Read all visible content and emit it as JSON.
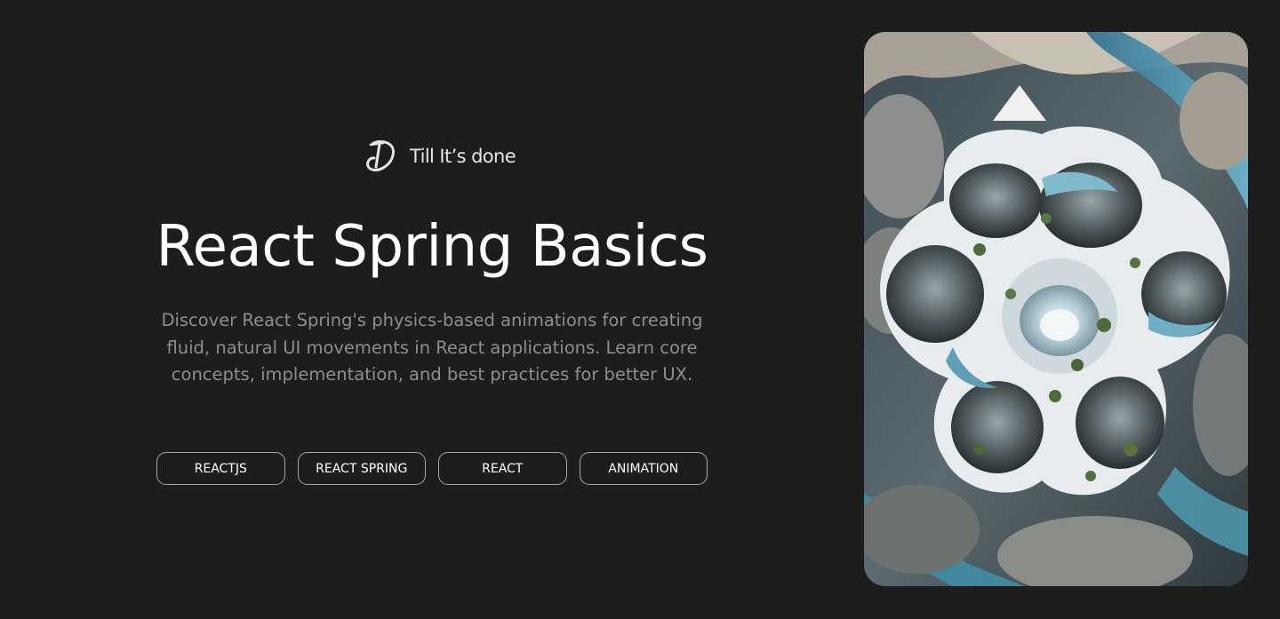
{
  "brand": {
    "name": "Till It’s done",
    "logo_icon": "td-monogram-icon"
  },
  "hero": {
    "title": "React Spring Basics",
    "description": "Discover React Spring's physics-based animations for creating fluid, natural UI movements in React applications. Learn core concepts, implementation, and best practices for better UX."
  },
  "tags": [
    {
      "label": "REACTJS"
    },
    {
      "label": "REACT SPRING"
    },
    {
      "label": "REACT"
    },
    {
      "label": "ANIMATION"
    }
  ],
  "image": {
    "subject": "aerial-architecture-illustration"
  },
  "colors": {
    "background": "#1d1d1d",
    "title": "#ffffff",
    "description": "#8e8e8e",
    "tag_border": "#a6a6a6"
  }
}
